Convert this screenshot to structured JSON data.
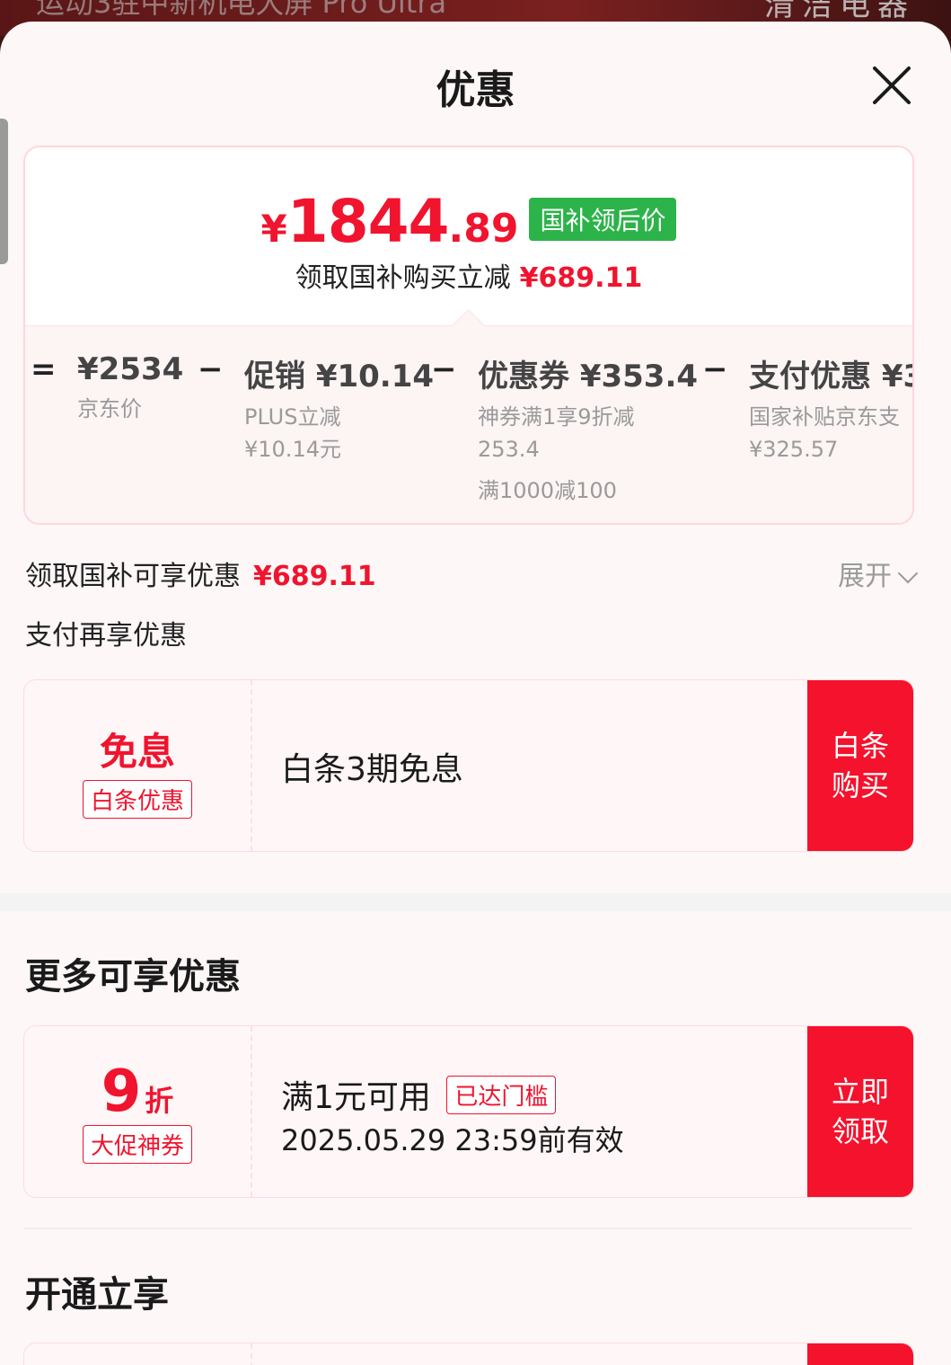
{
  "background_strip": {
    "left_text": "运动3驻中新机电大屏 Pro Ultra",
    "right_text": "清洁电器"
  },
  "header": {
    "title": "优惠"
  },
  "price_card": {
    "currency": "¥",
    "price_int": "1844",
    "price_dec": ".89",
    "tag": "国补领后价",
    "sub_label": "领取国补购买立减",
    "sub_amount": "¥689.11",
    "breakdown": [
      {
        "op": "=",
        "main": "¥2534",
        "desc": "京东价",
        "extra": ""
      },
      {
        "op": "−",
        "main": "促销 ¥10.14",
        "desc": "PLUS立减 ¥10.14元",
        "extra": ""
      },
      {
        "op": "−",
        "main": "优惠券 ¥353.4",
        "desc": "神券满1享9折减 253.4",
        "extra": "满1000减100"
      },
      {
        "op": "−",
        "main": "支付优惠 ¥3",
        "desc": "国家补贴京东支 ¥325.57",
        "extra": ""
      }
    ]
  },
  "enjoy_row": {
    "label": "领取国补可享优惠",
    "amount": "¥689.11",
    "expand": "展开"
  },
  "pay_section": {
    "title": "支付再享优惠"
  },
  "baitiao_coupon": {
    "big": "免息",
    "tag": "白条优惠",
    "text": "白条3期免息",
    "button_line1": "白条",
    "button_line2": "购买"
  },
  "more_section": {
    "title": "更多可享优惠"
  },
  "discount_coupon": {
    "value": "9",
    "unit": "折",
    "tag": "大促神券",
    "condition": "满1元可用",
    "status": "已达门槛",
    "expiry": "2025.05.29 23:59前有效",
    "button_line1": "立即",
    "button_line2": "领取"
  },
  "open_section": {
    "title": "开通立享"
  },
  "colors": {
    "accent_red": "#f0142e",
    "button_red": "#f5122c",
    "tag_green": "#2cb34a"
  }
}
